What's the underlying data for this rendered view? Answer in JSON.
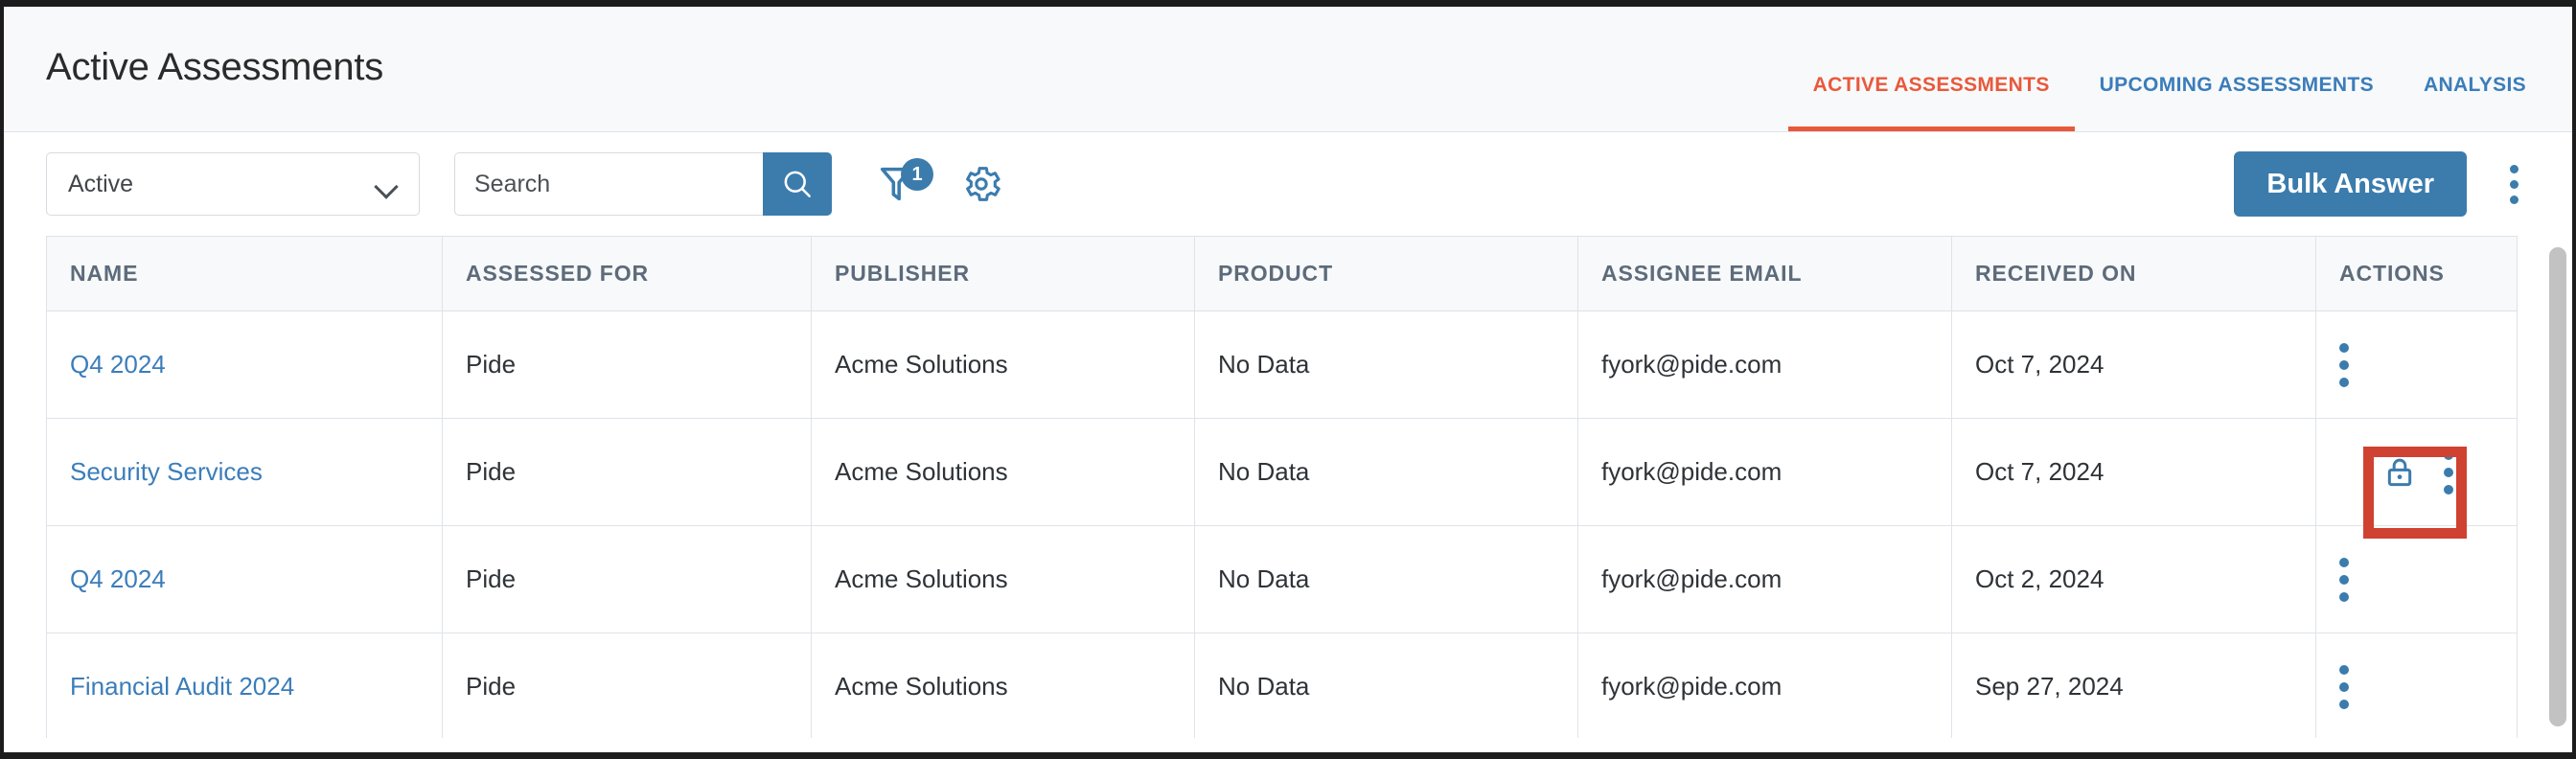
{
  "header": {
    "title": "Active Assessments",
    "tabs": [
      {
        "label": "ACTIVE ASSESSMENTS",
        "active": true
      },
      {
        "label": "UPCOMING ASSESSMENTS",
        "active": false
      },
      {
        "label": "ANALYSIS",
        "active": false
      }
    ]
  },
  "toolbar": {
    "status_filter": {
      "value": "Active",
      "icon": "chevron-down-icon"
    },
    "search": {
      "value": "",
      "placeholder": "Search",
      "button_icon": "search-icon"
    },
    "filter": {
      "icon": "filter-icon",
      "badge_count": "1"
    },
    "settings": {
      "icon": "gear-icon"
    },
    "bulk_answer_label": "Bulk Answer",
    "overflow_icon": "kebab-menu-icon"
  },
  "table": {
    "columns": [
      "NAME",
      "ASSESSED FOR",
      "PUBLISHER",
      "PRODUCT",
      "ASSIGNEE EMAIL",
      "RECEIVED ON",
      "ACTIONS"
    ],
    "rows": [
      {
        "name": "Q4 2024",
        "assessed_for": "Pide",
        "publisher": "Acme Solutions",
        "product": "No Data",
        "assignee_email": "fyork@pide.com",
        "received_on": "Oct 7, 2024",
        "action_icons": [
          "kebab-menu-icon"
        ],
        "highlighted": false
      },
      {
        "name": "Security Services",
        "assessed_for": "Pide",
        "publisher": "Acme Solutions",
        "product": "No Data",
        "assignee_email": "fyork@pide.com",
        "received_on": "Oct 7, 2024",
        "action_icons": [
          "lock-icon",
          "kebab-menu-icon"
        ],
        "highlighted": true
      },
      {
        "name": "Q4 2024",
        "assessed_for": "Pide",
        "publisher": "Acme Solutions",
        "product": "No Data",
        "assignee_email": "fyork@pide.com",
        "received_on": "Oct 2, 2024",
        "action_icons": [
          "kebab-menu-icon"
        ],
        "highlighted": false
      },
      {
        "name": "Financial Audit 2024",
        "assessed_for": "Pide",
        "publisher": "Acme Solutions",
        "product": "No Data",
        "assignee_email": "fyork@pide.com",
        "received_on": "Sep 27, 2024",
        "action_icons": [
          "kebab-menu-icon"
        ],
        "highlighted": false
      }
    ]
  },
  "colors": {
    "accent_blue": "#3b7cad",
    "link_blue": "#3b7dba",
    "active_tab_orange": "#e8593b",
    "annotation_red": "#cf4130",
    "header_bg": "#f8f9fa",
    "table_header_text": "#5d6b7a",
    "border": "#dfe3e8"
  }
}
